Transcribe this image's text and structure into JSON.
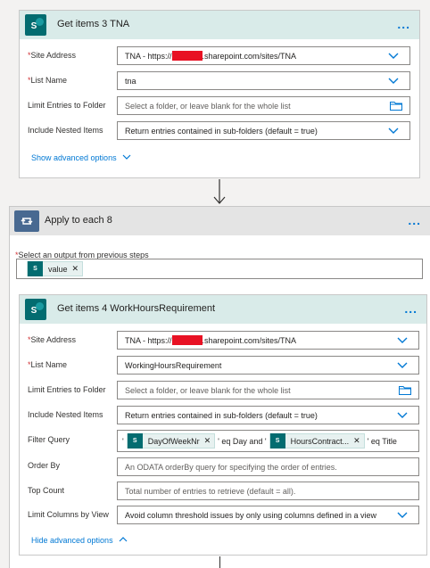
{
  "card1": {
    "title": "Get items 3 TNA",
    "more": "...",
    "fields": [
      {
        "label": "Site Address",
        "required": true,
        "value": "TNA - https://",
        "value_suffix": ".sharepoint.com/sites/TNA",
        "redacted": true,
        "control": "dropdown"
      },
      {
        "label": "List Name",
        "required": true,
        "value": "tna",
        "control": "dropdown"
      },
      {
        "label": "Limit Entries to Folder",
        "required": false,
        "placeholder": "Select a folder, or leave blank for the whole list",
        "control": "folder"
      },
      {
        "label": "Include Nested Items",
        "required": false,
        "value": "Return entries contained in sub-folders (default = true)",
        "control": "dropdown"
      }
    ],
    "advanced_link": "Show advanced options"
  },
  "loop": {
    "title": "Apply to each 8",
    "more": "...",
    "select_label": "Select an output from previous steps",
    "select_token": "value"
  },
  "card2": {
    "title": "Get items 4 WorkHoursRequirement",
    "more": "...",
    "fields": [
      {
        "label": "Site Address",
        "required": true,
        "value": "TNA - https://",
        "value_suffix": ".sharepoint.com/sites/TNA",
        "redacted": true,
        "control": "dropdown"
      },
      {
        "label": "List Name",
        "required": true,
        "value": "WorkingHoursRequirement",
        "control": "dropdown"
      },
      {
        "label": "Limit Entries to Folder",
        "required": false,
        "placeholder": "Select a folder, or leave blank for the whole list",
        "control": "folder"
      },
      {
        "label": "Include Nested Items",
        "required": false,
        "value": "Return entries contained in sub-folders (default = true)",
        "control": "dropdown"
      },
      {
        "label": "Filter Query",
        "required": false
      },
      {
        "label": "Order By",
        "required": false,
        "placeholder": "An ODATA orderBy query for specifying the order of entries."
      },
      {
        "label": "Top Count",
        "required": false,
        "placeholder": "Total number of entries to retrieve (default = all)."
      },
      {
        "label": "Limit Columns by View",
        "required": false,
        "value": "Avoid column threshold issues by only using columns defined in a view",
        "control": "dropdown"
      }
    ],
    "filter_query": {
      "prefix": "'",
      "token1": "DayOfWeekNr",
      "mid": "' eq Day and '",
      "token2": "HoursContract...",
      "suffix": "' eq Title"
    },
    "advanced_link": "Hide advanced options"
  },
  "icons": {
    "sharepoint": "sharepoint-icon",
    "loop": "apply-to-each-icon",
    "chevron": "chevron-down-icon",
    "folder": "folder-icon"
  },
  "colors": {
    "accent": "#0078d4",
    "sharepoint": "#036c70",
    "required": "#d13438",
    "redaction": "#e81123"
  }
}
